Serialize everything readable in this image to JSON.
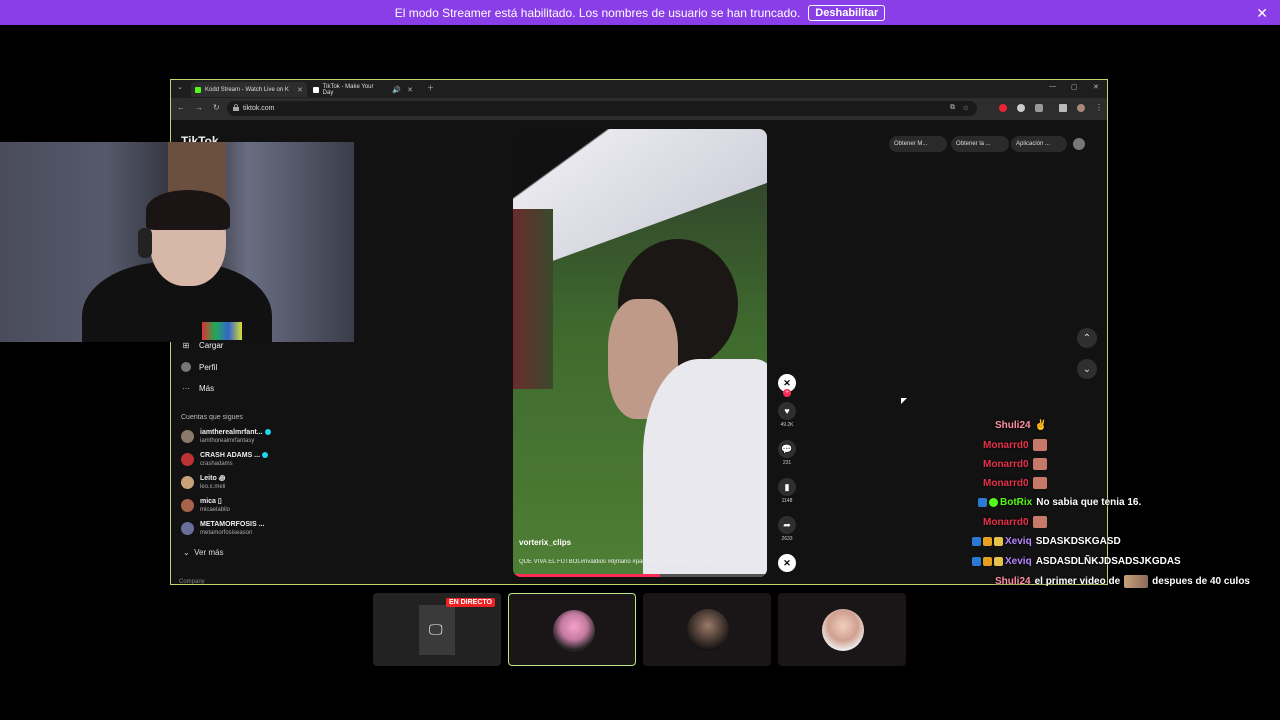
{
  "banner": {
    "message": "El modo Streamer está habilitado. Los nombres de usuario se han truncado.",
    "button": "Deshabilitar"
  },
  "browser": {
    "tabs": [
      {
        "title": "Kodd Stream - Watch Live on K"
      },
      {
        "title": "TikTok - Make Your Day"
      }
    ],
    "url": "tiktok.com"
  },
  "tiktok": {
    "logo": "TikTok",
    "top_buttons": [
      "Obtener M...",
      "Obtener la ...",
      "Aplicación ..."
    ],
    "nav": [
      "Cargar",
      "Perfil",
      "Más"
    ],
    "section_title": "Cuentas que sigues",
    "accounts": [
      {
        "name": "iamtherealmrfant...",
        "handle": "iamthorealmrfantasy",
        "verified": true
      },
      {
        "name": "CRASH ADAMS ...",
        "handle": "crashadams",
        "verified": true
      },
      {
        "name": "Leito ꩜",
        "handle": "leo.x.meli",
        "verified": false
      },
      {
        "name": "mica ▯",
        "handle": "micaelabilo",
        "verified": false
      },
      {
        "name": "METAMORFOSIS ...",
        "handle": "metamorfosiseason",
        "verified": false
      }
    ],
    "see_more": "Ver más",
    "company": "Company",
    "video": {
      "username": "vorterix_clips",
      "description": "QUE VIVA EL FUTBOL#rivaldios #djmario #partidazodeyoutubers ... más",
      "progress": 0.58
    },
    "actions": [
      {
        "icon": "heart-icon",
        "count": "49.2K"
      },
      {
        "icon": "comment-icon",
        "count": "231"
      },
      {
        "icon": "bookmark-icon",
        "count": "1148"
      },
      {
        "icon": "share-icon",
        "count": "2633"
      }
    ]
  },
  "live_badge": "EN DIRECTO",
  "chat": [
    {
      "user": "Shuli24",
      "color": "#ff8fa3",
      "text": ""
    },
    {
      "user": "Monarrd0",
      "color": "#e8324a",
      "text": ""
    },
    {
      "user": "Monarrd0",
      "color": "#e8324a",
      "text": ""
    },
    {
      "user": "Monarrd0",
      "color": "#e8324a",
      "text": ""
    },
    {
      "user": "BotRix",
      "color": "#53fc18",
      "text": "No sabia que tenia 16."
    },
    {
      "user": "Monarrd0",
      "color": "#e8324a",
      "text": ""
    },
    {
      "user": "Xeviq",
      "color": "#b786ff",
      "text": "SDASKDSKGASD"
    },
    {
      "user": "Xeviq",
      "color": "#b786ff",
      "text": "ASDASDLÑKJDSADSJKGDAS"
    },
    {
      "user": "Shuli24",
      "color": "#ff8fa3",
      "text": "el primer video de",
      "text2": "despues de 40 culos"
    }
  ]
}
